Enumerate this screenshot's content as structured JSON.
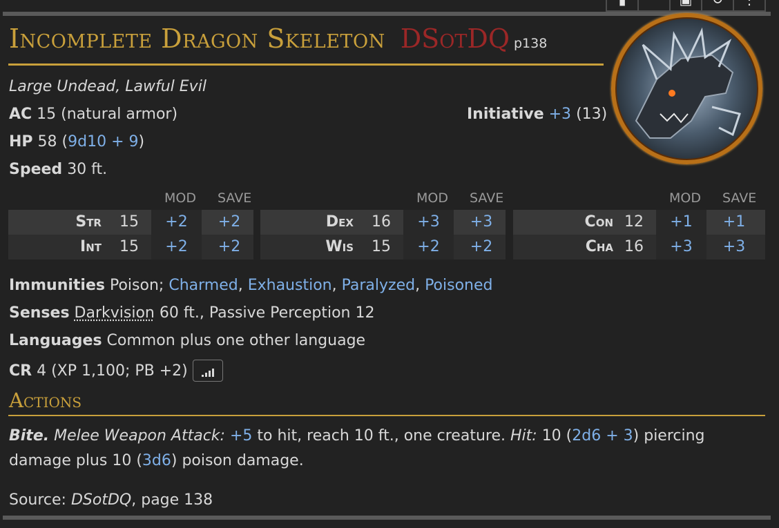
{
  "toolbar": {
    "buttons": [
      "pin-icon",
      "blank-icon",
      "image-icon",
      "refresh-icon",
      "more-icon"
    ]
  },
  "monster": {
    "name": "Incomplete Dragon Skeleton",
    "source_abbr": "DSotDQ",
    "source_page": "p138",
    "type_line": "Large Undead, Lawful Evil",
    "ac": {
      "label": "AC",
      "value": "15 (natural armor)"
    },
    "initiative": {
      "label": "Initiative",
      "mod": "+3",
      "score": "(13)"
    },
    "hp": {
      "label": "HP",
      "value": "58",
      "dice": "9d10 + 9"
    },
    "speed": {
      "label": "Speed",
      "value": "30 ft."
    }
  },
  "abilities": {
    "headers": {
      "mod": "MOD",
      "save": "SAVE"
    },
    "groups": [
      {
        "rows": [
          {
            "name": "Str",
            "score": "15",
            "mod": "+2",
            "save": "+2"
          },
          {
            "name": "Int",
            "score": "15",
            "mod": "+2",
            "save": "+2"
          }
        ]
      },
      {
        "rows": [
          {
            "name": "Dex",
            "score": "16",
            "mod": "+3",
            "save": "+3"
          },
          {
            "name": "Wis",
            "score": "15",
            "mod": "+2",
            "save": "+2"
          }
        ]
      },
      {
        "rows": [
          {
            "name": "Con",
            "score": "12",
            "mod": "+1",
            "save": "+1"
          },
          {
            "name": "Cha",
            "score": "16",
            "mod": "+3",
            "save": "+3"
          }
        ]
      }
    ]
  },
  "immunities": {
    "label": "Immunities",
    "plain": "Poison;",
    "conditions": [
      "Charmed",
      "Exhaustion",
      "Paralyzed",
      "Poisoned"
    ]
  },
  "senses": {
    "label": "Senses",
    "darkvision": "Darkvision",
    "rest": "60 ft., Passive Perception 12"
  },
  "languages": {
    "label": "Languages",
    "value": "Common plus one other language"
  },
  "cr": {
    "label": "CR",
    "value": "4 (XP 1,100; PB +2)"
  },
  "actions": {
    "heading": "Actions",
    "bite": {
      "name": "Bite.",
      "attack_type": "Melee Weapon Attack:",
      "to_hit": "+5",
      "text1": "to hit, reach 10 ft., one creature.",
      "hit_label": "Hit:",
      "dmg1": "10",
      "dice1": "2d6 + 3",
      "text2": "piercing damage plus 10",
      "dice2": "3d6",
      "text3": "poison damage."
    }
  },
  "source": {
    "label": "Source:",
    "book": "DSotDQ",
    "page": "page 138"
  }
}
